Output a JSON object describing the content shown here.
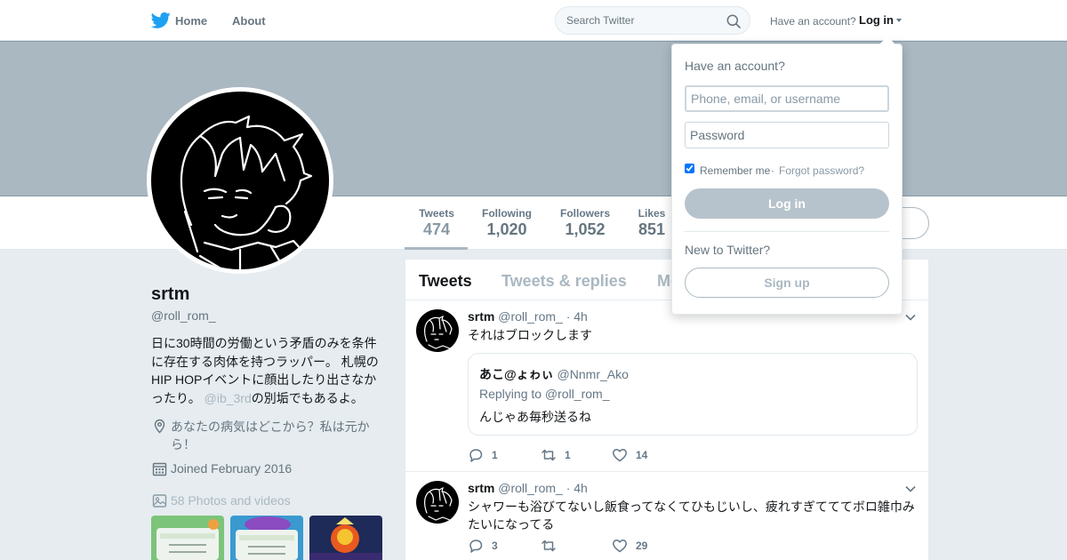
{
  "colors": {
    "nav_text": "#66757f",
    "brand": "#1da1f2",
    "banner": "#aab8c2",
    "page_bg": "#e6ecf0",
    "muted": "#8899a6"
  },
  "topnav": {
    "logo_icon": "twitter-bird-icon",
    "home_label": "Home",
    "about_label": "About",
    "search_placeholder": "Search Twitter",
    "search_icon": "search-icon",
    "account_prompt": "Have an account?",
    "login_label": "Log in"
  },
  "profile_nav": {
    "stats": [
      {
        "label": "Tweets",
        "value": "474"
      },
      {
        "label": "Following",
        "value": "1,020"
      },
      {
        "label": "Followers",
        "value": "1,052"
      },
      {
        "label": "Likes",
        "value": "851"
      }
    ]
  },
  "profile": {
    "name": "srtm",
    "handle": "@roll_rom_",
    "bio_before": "日に30時間の労働という矛盾のみを条件に存在する肉体を持つラッパー。 札幌のHIP HOPイベントに顔出したり出さなかったり。 ",
    "bio_mention": "@ib_3rd",
    "bio_after": "の別垢でもあるよ。",
    "location": "あなたの病気はどこから？私は元から！",
    "joined": "Joined February 2016",
    "photos": "58 Photos and videos"
  },
  "timeline": {
    "tabs": [
      "Tweets",
      "Tweets & replies",
      "Media"
    ],
    "tweets": [
      {
        "name": "srtm",
        "handle": "@roll_rom_",
        "time": "· 4h",
        "text": "それはブロックします",
        "quote": {
          "name": "あこ@ょゎぃ",
          "handle": "@Nnmr_Ako",
          "replying": "Replying to @roll_rom_",
          "text": "んじゃあ毎秒送るね"
        },
        "replies": "1",
        "retweets": "1",
        "likes": "14"
      },
      {
        "name": "srtm",
        "handle": "@roll_rom_",
        "time": "· 4h",
        "text": "シャワーも浴びてないし飯食ってなくてひもじいし、疲れすぎてててボロ雑巾みたいになってる",
        "replies": "3",
        "retweets": "",
        "likes": "29"
      }
    ]
  },
  "login_dropdown": {
    "heading": "Have an account?",
    "username_placeholder": "Phone, email, or username",
    "password_placeholder": "Password",
    "remember_label": "Remember me",
    "separator": "·",
    "forgot_label": "Forgot password?",
    "login_button": "Log in",
    "new_prompt": "New to Twitter?",
    "signup_button": "Sign up"
  }
}
